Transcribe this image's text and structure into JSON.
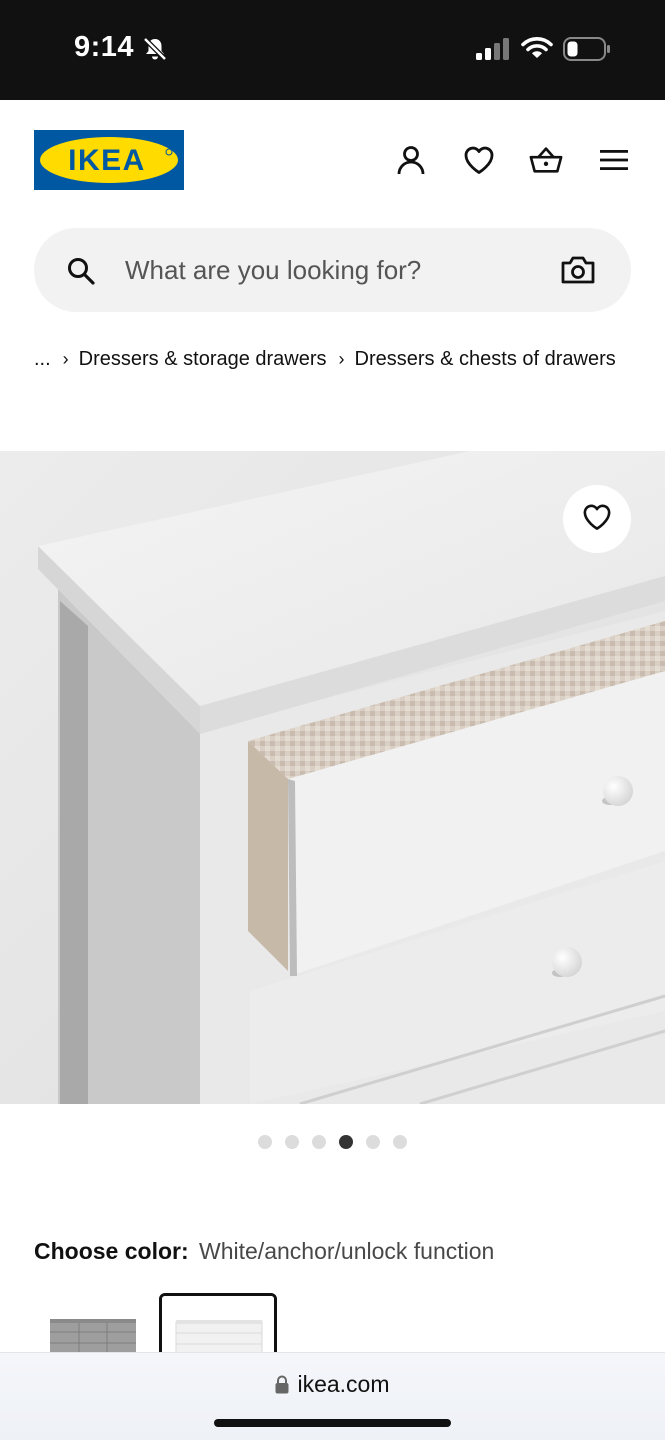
{
  "status_bar": {
    "time": "9:14",
    "icons": [
      "bell-slash-icon",
      "signal-icon",
      "wifi-icon",
      "battery-icon"
    ]
  },
  "header": {
    "logo_text": "IKEA",
    "icons": [
      "user-icon",
      "heart-icon",
      "basket-icon",
      "menu-icon"
    ],
    "brand_colors": {
      "blue": "#0058a3",
      "yellow": "#ffdb00"
    }
  },
  "search": {
    "placeholder": "What are you looking for?",
    "icons": [
      "search-icon",
      "camera-icon"
    ]
  },
  "breadcrumb": {
    "items": [
      "...",
      "Dressers & storage drawers",
      "Dressers & chests of drawers"
    ]
  },
  "gallery": {
    "slide_count": 6,
    "active_index": 3,
    "favorite_icon": "heart-icon"
  },
  "color_chooser": {
    "label": "Choose color:",
    "value": "White/anchor/unlock function",
    "selected_index": 1
  },
  "browser": {
    "url": "ikea.com"
  }
}
